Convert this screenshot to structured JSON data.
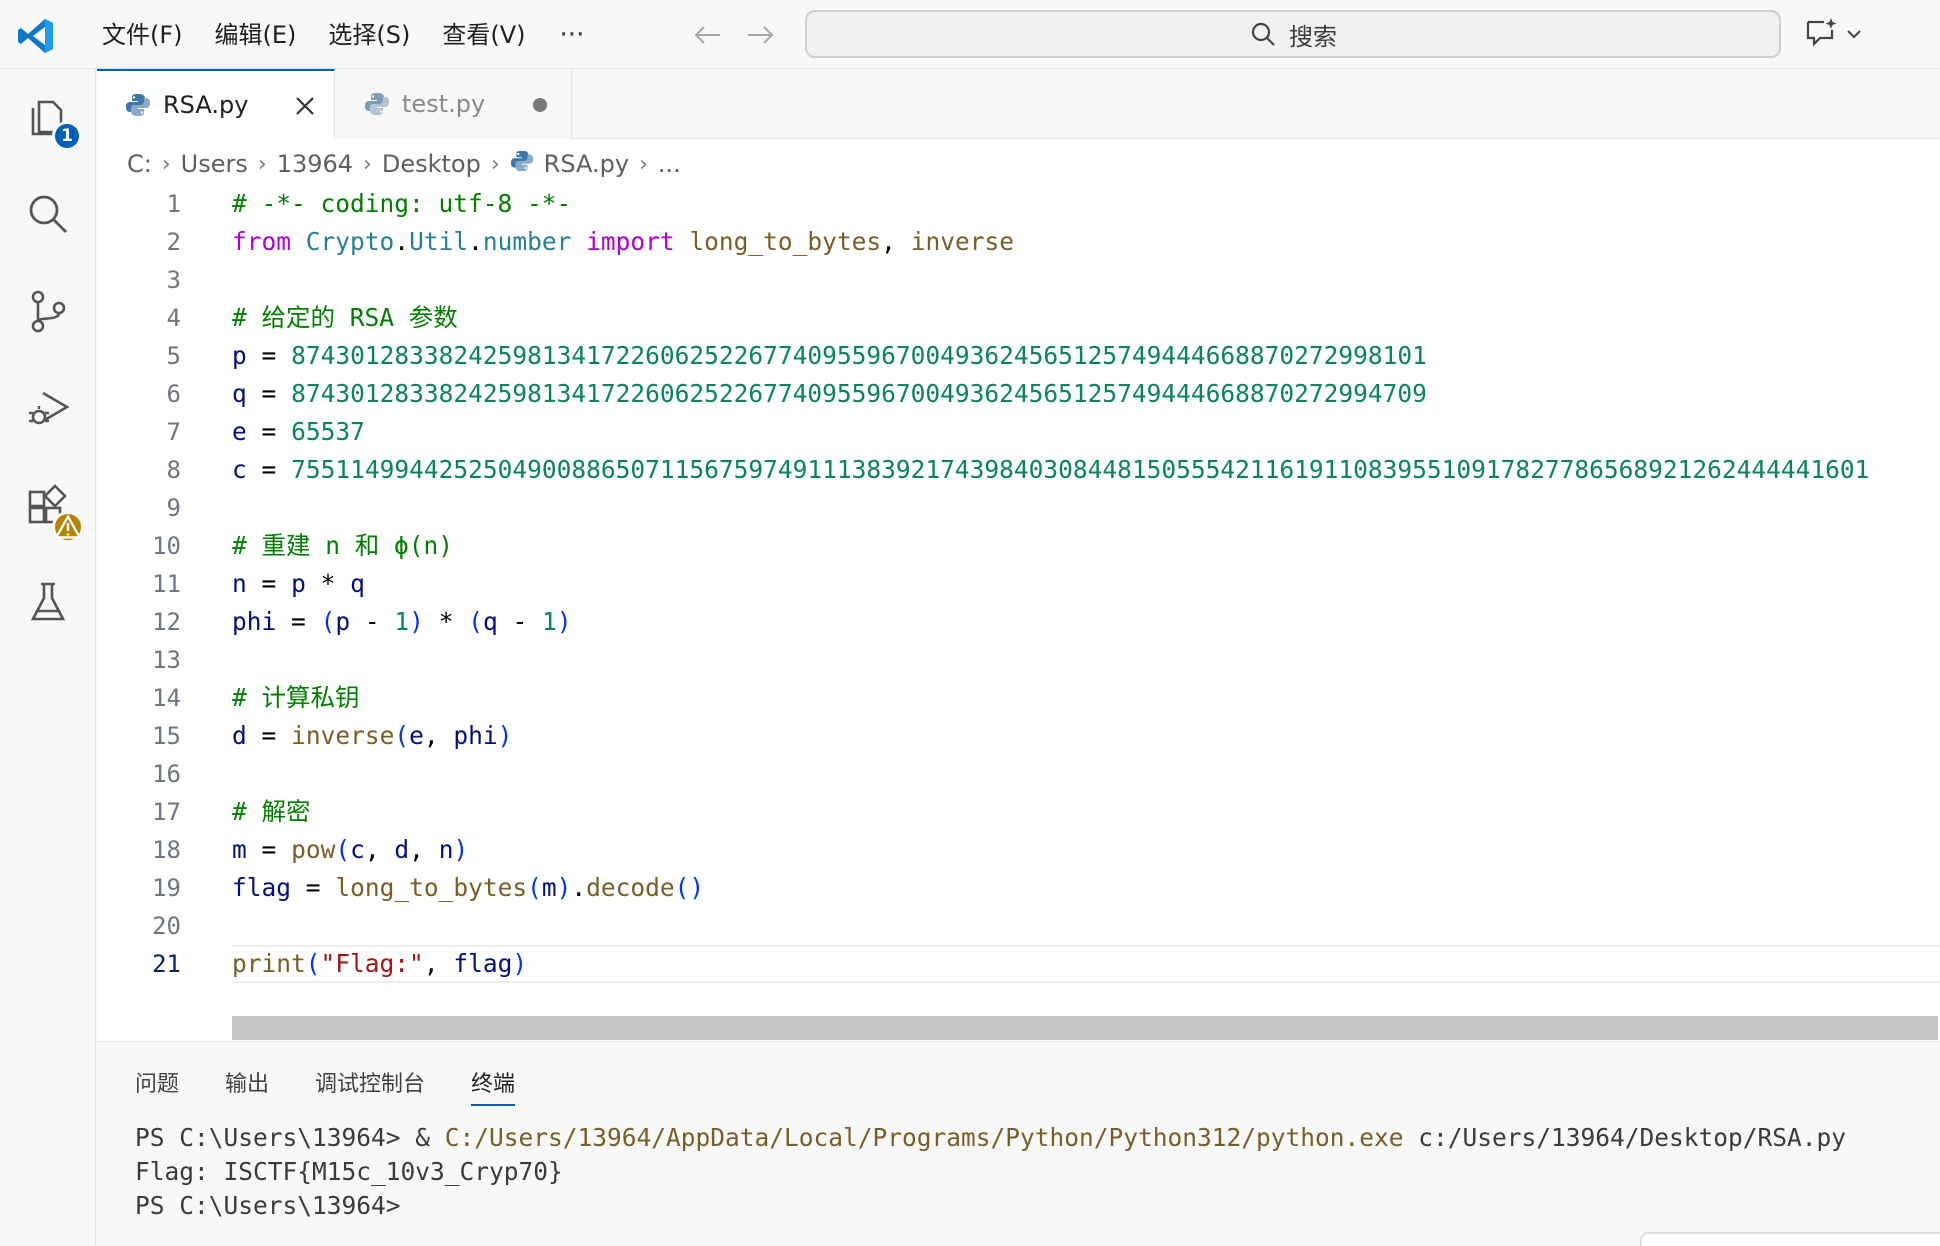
{
  "menu": {
    "items": [
      "文件(F)",
      "编辑(E)",
      "选择(S)",
      "查看(V)"
    ],
    "more": "···"
  },
  "search": {
    "label": "搜索"
  },
  "activity": {
    "explorer_badge": "1"
  },
  "tabs": [
    {
      "label": "RSA.py",
      "active": true
    },
    {
      "label": "test.py",
      "active": false,
      "dirty": true
    }
  ],
  "breadcrumb": {
    "parts": [
      "C:",
      "Users",
      "13964",
      "Desktop"
    ],
    "file": "RSA.py",
    "tail": "..."
  },
  "editor": {
    "current_line": 21,
    "lines": [
      "# -*- coding: utf-8 -*-",
      "from Crypto.Util.number import long_to_bytes, inverse",
      "",
      "# 给定的 RSA 参数",
      "p = 8743012833824259813417226062522677409559670049362456512574944466887027299810​1",
      "q = 8743012833824259813417226062522677409559670049362456512574944466887027299470​9",
      "e = 65537",
      "c = 755114994425250490088650711567597491113839217439840308448150555421161911083955109178277865689212624444416​01",
      "",
      "# 重建 n 和 ϕ(n)",
      "n = p * q",
      "phi = (p - 1) * (q - 1)",
      "",
      "# 计算私钥",
      "d = inverse(e, phi)",
      "",
      "# 解密",
      "m = pow(c, d, n)",
      "flag = long_to_bytes(m).decode()",
      "",
      "print(\"Flag:\", flag)"
    ]
  },
  "panel": {
    "tabs": [
      "问题",
      "输出",
      "调试控制台",
      "终端"
    ],
    "active_tab": "终端",
    "terminal": {
      "line1_prompt": "PS C:\\Users\\13964> & ",
      "line1_exe": "C:/Users/13964/AppData/Local/Programs/Python/Python312/python.exe",
      "line1_arg": " c:/Users/13964/Desktop/RSA.py",
      "line2": "Flag: ISCTF{M15c_10v3_Cryp70}",
      "line3": "PS C:\\Users\\13964>"
    }
  }
}
